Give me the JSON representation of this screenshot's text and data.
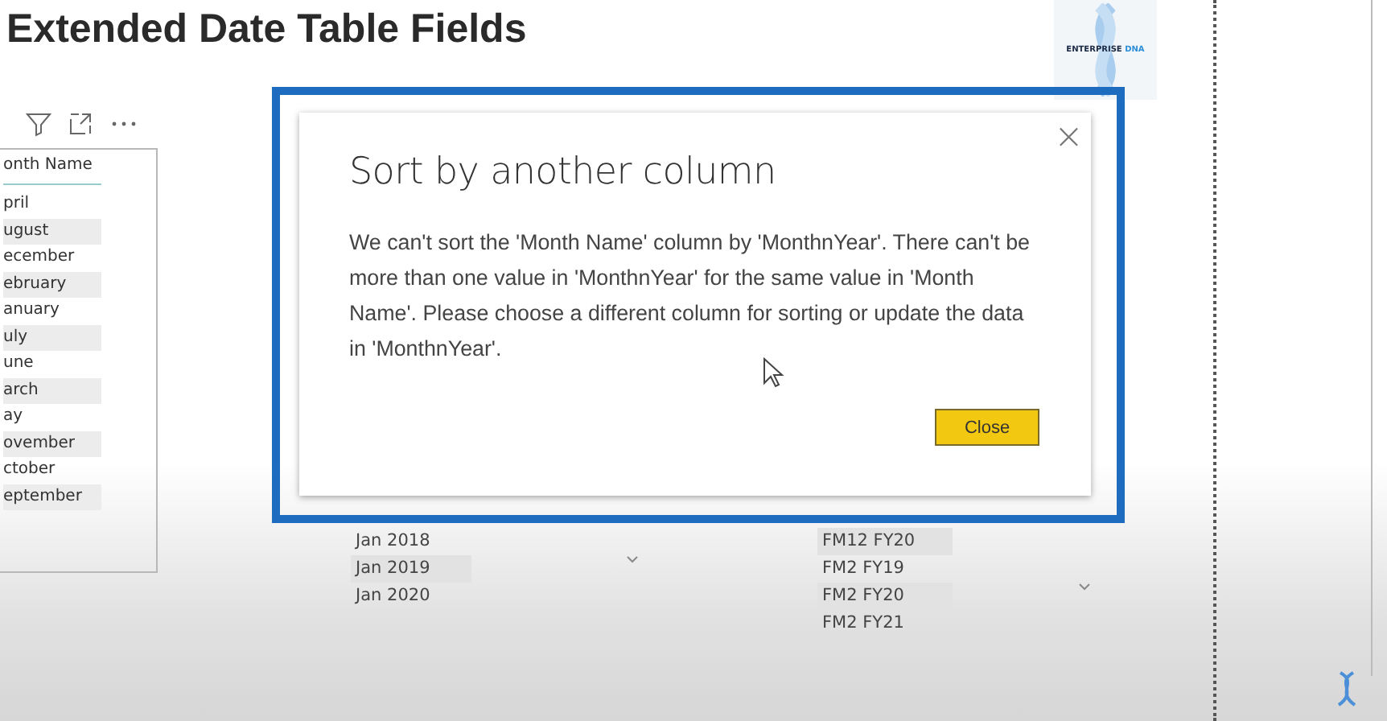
{
  "page_title": "Extended Date Table Fields",
  "logo": {
    "text": "ENTERPRISE",
    "accent": "DNA"
  },
  "month_table": {
    "header": "onth Name",
    "rows": [
      "pril",
      "ugust",
      "ecember",
      "ebruary",
      "anuary",
      "uly",
      "une",
      "arch",
      "ay",
      "ovember",
      "ctober",
      "eptember"
    ]
  },
  "date_list": {
    "items": [
      "Jan 2018",
      "Jan 2019",
      "Jan 2020"
    ]
  },
  "fiscal_list": {
    "items": [
      "FM12 FY20",
      "FM2 FY19",
      "FM2 FY20",
      "FM2 FY21"
    ]
  },
  "dialog": {
    "title": "Sort by another column",
    "message": "We can't sort the 'Month Name' column by 'MonthnYear'. There can't be more than one value in 'MonthnYear' for the same value in 'Month Name'. Please choose a different column for sorting or update the data in 'MonthnYear'.",
    "close_label": "×",
    "buttons": [
      "Close"
    ]
  }
}
